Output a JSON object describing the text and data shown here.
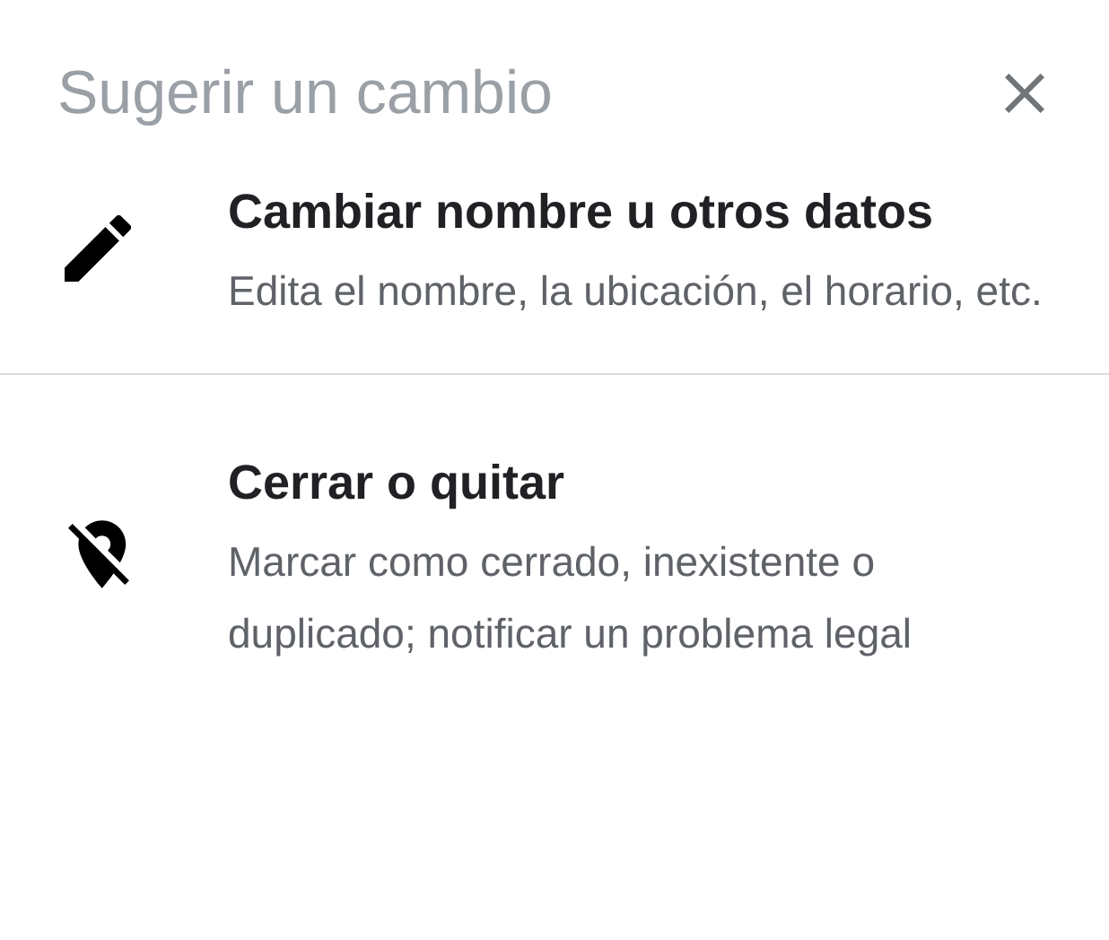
{
  "dialog": {
    "title": "Sugerir un cambio",
    "options": [
      {
        "kind": "edit",
        "title": "Cambiar nombre u otros datos",
        "description": "Edita el nombre, la ubicación, el horario, etc."
      },
      {
        "kind": "close",
        "title": "Cerrar o quitar",
        "description": "Marcar como cerrado, inexistente o duplicado; notificar un problema legal"
      }
    ]
  }
}
